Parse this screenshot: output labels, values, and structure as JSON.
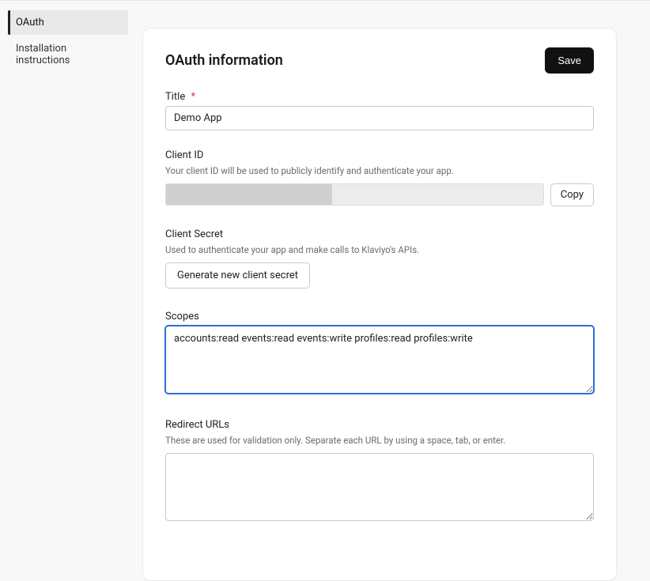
{
  "sidebar": {
    "items": [
      {
        "label": "OAuth",
        "active": true
      },
      {
        "label": "Installation instructions",
        "active": false
      }
    ]
  },
  "header": {
    "title": "OAuth information",
    "save_label": "Save"
  },
  "form": {
    "title": {
      "label": "Title",
      "required_marker": "*",
      "value": "Demo App"
    },
    "client_id": {
      "label": "Client ID",
      "help": "Your client ID will be used to publicly identify and authenticate your app.",
      "value": "",
      "copy_label": "Copy"
    },
    "client_secret": {
      "label": "Client Secret",
      "help": "Used to authenticate your app and make calls to Klaviyo's APIs.",
      "generate_label": "Generate new client secret"
    },
    "scopes": {
      "label": "Scopes",
      "value": "accounts:read events:read events:write profiles:read profiles:write"
    },
    "redirect": {
      "label": "Redirect URLs",
      "help": "These are used for validation only. Separate each URL by using a space, tab, or enter.",
      "value": ""
    }
  }
}
